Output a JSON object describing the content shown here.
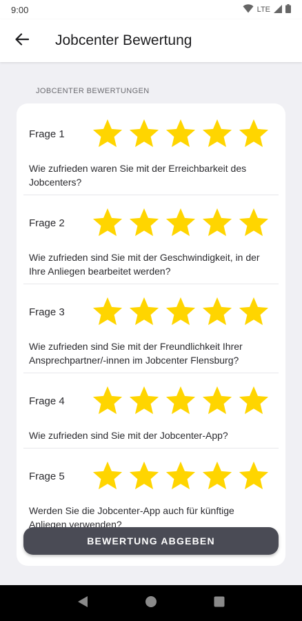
{
  "status_bar": {
    "time": "9:00",
    "network": "LTE"
  },
  "app_bar": {
    "title": "Jobcenter Bewertung"
  },
  "section": {
    "label": "JOBCENTER BEWERTUNGEN"
  },
  "star_color": "#FFD500",
  "questions": [
    {
      "label": "Frage 1",
      "rating": 5,
      "max": 5,
      "text": "Wie zufrieden waren Sie mit der Erreichbarkeit des Jobcenters?"
    },
    {
      "label": "Frage 2",
      "rating": 5,
      "max": 5,
      "text": "Wie zufrieden sind Sie mit der Geschwindigkeit, in der Ihre Anliegen bearbeitet werden?"
    },
    {
      "label": "Frage 3",
      "rating": 5,
      "max": 5,
      "text": "Wie zufrieden sind Sie mit der Freundlichkeit Ihrer Ansprechpartner/-innen im Jobcenter Flensburg?"
    },
    {
      "label": "Frage 4",
      "rating": 5,
      "max": 5,
      "text": "Wie zufrieden sind Sie mit der Jobcenter-App?"
    },
    {
      "label": "Frage 5",
      "rating": 5,
      "max": 5,
      "text": "Werden Sie die Jobcenter-App auch für künftige Anliegen verwenden?"
    }
  ],
  "submit": {
    "label": "BEWERTUNG ABGEBEN"
  },
  "icons": {
    "back": "arrow-left-icon",
    "wifi": "wifi-icon",
    "signal": "signal-icon",
    "battery": "battery-icon",
    "nav_back": "nav-back-icon",
    "nav_home": "nav-home-icon",
    "nav_recents": "nav-recents-icon"
  }
}
